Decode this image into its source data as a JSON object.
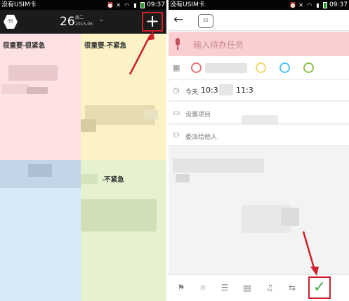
{
  "left_phone": {
    "status_bar": {
      "carrier": "没有USIM卡",
      "time": "09:37"
    },
    "header": {
      "hex_badge": "35",
      "day": "26",
      "weekday": "周二",
      "year_month": "2015-05",
      "chevron_icon": "chevron-down-icon",
      "add_button_label": "+"
    },
    "quadrants": [
      {
        "label": "很重要-很紧急",
        "color": "#fde1e3"
      },
      {
        "label": "很重要-不紧急",
        "color": "#fbf3c6"
      },
      {
        "label": "",
        "color": "#d5e9f8"
      },
      {
        "label": "-不紧急",
        "color": "#e6f2cf"
      }
    ]
  },
  "right_phone": {
    "status_bar": {
      "carrier": "没有USIM卡",
      "time": "09:37"
    },
    "header": {
      "back_icon": "back-arrow-icon",
      "hex_badge": "35"
    },
    "input": {
      "placeholder": "输入待办任务"
    },
    "priority_colors": [
      "#e57373",
      "#f2d96b",
      "#4fc3f7",
      "#8bc34a"
    ],
    "time_row": {
      "prefix": "今天",
      "start": "10:3",
      "end": "11:3"
    },
    "project_row": {
      "label": "设置项目"
    },
    "delegate_row": {
      "label": "委派给他人"
    },
    "toolbar": {
      "icons": [
        "bookmark-icon",
        "location-icon",
        "list-icon",
        "note-icon",
        "bell-icon",
        "repeat-icon"
      ],
      "confirm_label": "✓"
    }
  },
  "annotation_color": "#d0202a"
}
